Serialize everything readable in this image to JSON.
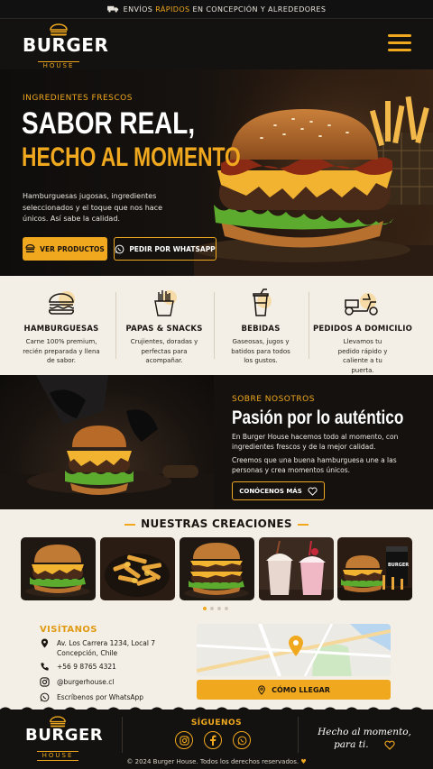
{
  "topbar": {
    "pre": "ENVÍOS",
    "highlight": "RÁPIDOS",
    "post": "EN CONCEPCIÓN Y ALREDEDORES"
  },
  "logo": {
    "line1": "BURGER",
    "line2": "HOUSE"
  },
  "hero": {
    "eyebrow": "INGREDIENTES FRESCOS",
    "title_line1": "SABOR REAL,",
    "title_line2": "HECHO AL MOMENTO",
    "description": "Hamburguesas jugosas, ingredientes seleccionados y el toque que nos hace únicos. Así sabe la calidad.",
    "btn_products": "VER PRODUCTOS",
    "btn_whatsapp": "PEDIR POR WHATSAPP"
  },
  "features": [
    {
      "title": "HAMBURGUESAS",
      "text": "Carne 100% premium, recién preparada y llena de sabor.",
      "icon": "burger-icon"
    },
    {
      "title": "PAPAS & SNACKS",
      "text": "Crujientes, doradas y perfectas para acompañar.",
      "icon": "fries-icon"
    },
    {
      "title": "BEBIDAS",
      "text": "Gaseosas, jugos y batidos para todos los gustos.",
      "icon": "drink-icon"
    },
    {
      "title": "PEDIDOS A DOMICILIO",
      "text": "Llevamos tu pedido rápido y caliente a tu puerta.",
      "icon": "scooter-icon"
    }
  ],
  "about": {
    "eyebrow": "SOBRE NOSOTROS",
    "title": "Pasión por lo auténtico",
    "p1": "En Burger House hacemos todo al momento, con ingredientes frescos y de la mejor calidad.",
    "p2": "Creemos que una buena hamburguesa une a las personas y crea momentos únicos.",
    "btn": "CONÓCENOS MÁS"
  },
  "creations": {
    "title": "NUESTRAS CREACIONES",
    "slides": 4,
    "active": 1
  },
  "visit": {
    "title": "VISÍTANOS",
    "address": "Av. Los Carrera 1234, Local 7 Concepción, Chile",
    "phone": "+56 9 8765 4321",
    "instagram": "@burgerhouse.cl",
    "whatsapp": "Escríbenos por WhatsApp",
    "btn": "CÓMO LLEGAR"
  },
  "footer": {
    "follow": "SÍGUENOS",
    "signature_line1": "Hecho al momento,",
    "signature_line2": "para ti.",
    "copyright": "© 2024 Burger House. Todos los derechos reservados."
  },
  "colors": {
    "accent": "#f0a81e",
    "dark": "#141210",
    "cream": "#f4efe6"
  }
}
